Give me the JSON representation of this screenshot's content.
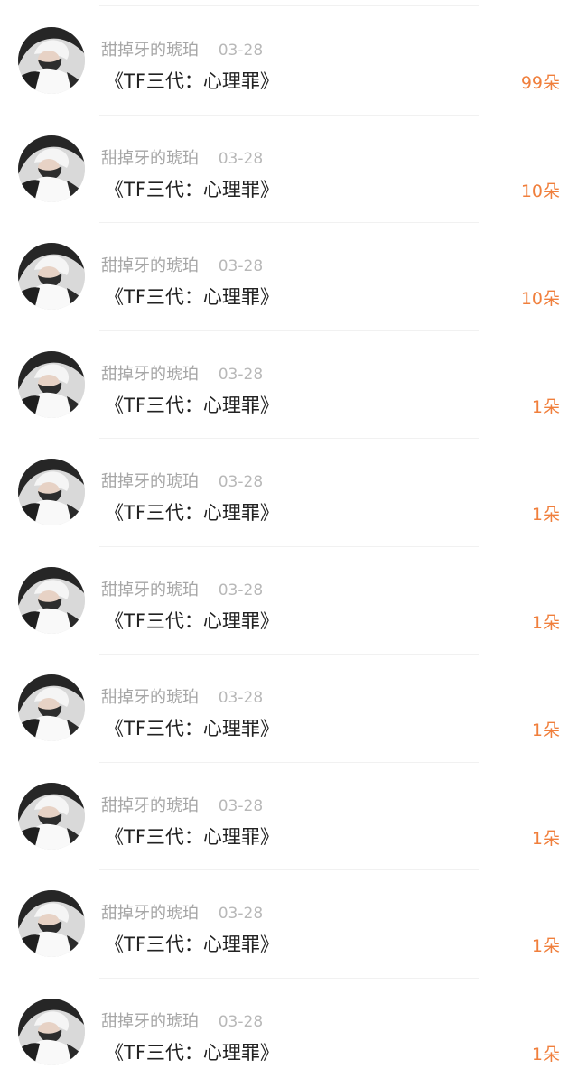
{
  "entries": [
    {
      "username": "甜掉牙的琥珀",
      "date": "03-28",
      "gift": "《TF三代：心理罪》",
      "count": "99朵"
    },
    {
      "username": "甜掉牙的琥珀",
      "date": "03-28",
      "gift": "《TF三代：心理罪》",
      "count": "10朵"
    },
    {
      "username": "甜掉牙的琥珀",
      "date": "03-28",
      "gift": "《TF三代：心理罪》",
      "count": "10朵"
    },
    {
      "username": "甜掉牙的琥珀",
      "date": "03-28",
      "gift": "《TF三代：心理罪》",
      "count": "1朵"
    },
    {
      "username": "甜掉牙的琥珀",
      "date": "03-28",
      "gift": "《TF三代：心理罪》",
      "count": "1朵"
    },
    {
      "username": "甜掉牙的琥珀",
      "date": "03-28",
      "gift": "《TF三代：心理罪》",
      "count": "1朵"
    },
    {
      "username": "甜掉牙的琥珀",
      "date": "03-28",
      "gift": "《TF三代：心理罪》",
      "count": "1朵"
    },
    {
      "username": "甜掉牙的琥珀",
      "date": "03-28",
      "gift": "《TF三代：心理罪》",
      "count": "1朵"
    },
    {
      "username": "甜掉牙的琥珀",
      "date": "03-28",
      "gift": "《TF三代：心理罪》",
      "count": "1朵"
    },
    {
      "username": "甜掉牙的琥珀",
      "date": "03-28",
      "gift": "《TF三代：心理罪》",
      "count": "1朵"
    }
  ],
  "colors": {
    "count": "#f07f3c",
    "username": "#a6a6a6",
    "date": "#b8b8b8",
    "gift": "#222222",
    "divider": "#f1f1f1"
  },
  "icons": {
    "avatar": "user-avatar-photo"
  }
}
